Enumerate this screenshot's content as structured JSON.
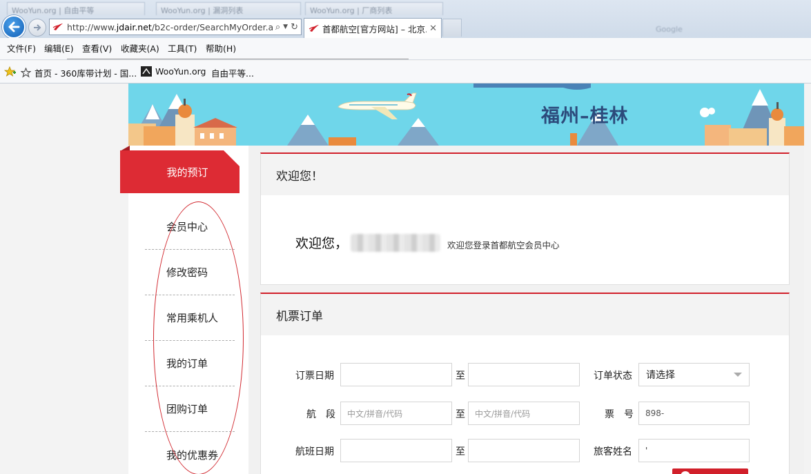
{
  "browser": {
    "bg_tabs": [
      "WooYun.org | 自由平等",
      "WooYun.org | 漏洞列表",
      "WooYun.org | 厂商列表"
    ],
    "address_prefix": "http://www.",
    "address_domain": "jdair.net",
    "address_suffix": "/b2c-order/SearchMyOrder.a",
    "active_tab_title": "首都航空[官方网站] – 北京...",
    "menu": [
      "文件(F)",
      "编辑(E)",
      "查看(V)",
      "收藏夹(A)",
      "工具(T)",
      "帮助(H)"
    ],
    "favorites": [
      "首页 - 360库带计划 - 国...",
      "WooYun.org",
      "自由平等..."
    ],
    "blurred_right": "Google"
  },
  "banner": {
    "route": "福州–桂林"
  },
  "sidebar": {
    "active": "我的预订",
    "items": [
      "会员中心",
      "修改密码",
      "常用乘机人",
      "我的订单",
      "团购订单",
      "我的优惠券"
    ]
  },
  "welcome_panel": {
    "title": "欢迎您！",
    "greeting": "欢迎您，",
    "subtext": "欢迎您登录首都航空会员中心"
  },
  "order_panel": {
    "title": "机票订单",
    "labels": {
      "booking_date": "订票日期",
      "segment": "航　段",
      "flight_date": "航班日期",
      "order_status": "订单状态",
      "ticket_no": "票　号",
      "passenger_name": "旅客姓名",
      "to": "至"
    },
    "segment_placeholder": "中文/拼音/代码",
    "status_selected": "请选择",
    "ticket_no_value": "898-",
    "passenger_value": "'"
  },
  "colors": {
    "accent": "#dd2b34",
    "banner_sky": "#6fd6ea",
    "route_text": "#2c4a7b",
    "annotation": "#d1272e"
  }
}
